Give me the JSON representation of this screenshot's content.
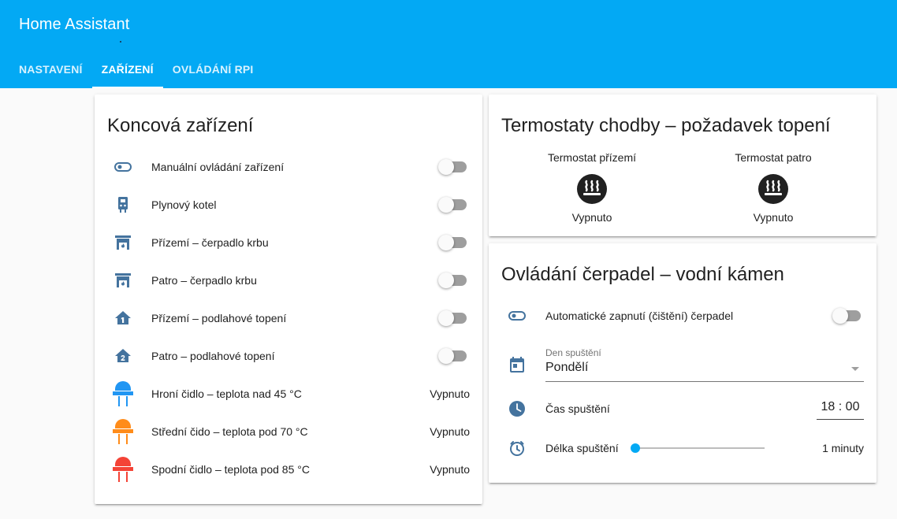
{
  "app": {
    "title": "Home Assistant"
  },
  "tabs": [
    {
      "label": "NASTAVENÍ",
      "active": false
    },
    {
      "label": "ZAŘÍZENÍ",
      "active": true
    },
    {
      "label": "OVLÁDÁNÍ RPI",
      "active": false
    }
  ],
  "colors": {
    "header": "#03a9f4",
    "icon": "#44739e",
    "sensor_blue": "#2196f3",
    "sensor_orange": "#ff8c1a",
    "sensor_red": "#f44336"
  },
  "devices_card": {
    "title": "Koncová zařízení",
    "rows": [
      {
        "icon": "toggle-switch-icon",
        "label": "Manuální ovládání zařízení",
        "type": "toggle",
        "on": false
      },
      {
        "icon": "gas-boiler-icon",
        "label": "Plynový kotel",
        "type": "toggle",
        "on": false
      },
      {
        "icon": "fireplace-icon",
        "label": "Přízemí – čerpadlo krbu",
        "type": "toggle",
        "on": false
      },
      {
        "icon": "fireplace-icon",
        "label": "Patro – čerpadlo krbu",
        "type": "toggle",
        "on": false
      },
      {
        "icon": "home-floor-1-icon",
        "label": "Přízemí – podlahové topení",
        "type": "toggle",
        "on": false
      },
      {
        "icon": "home-floor-2-icon",
        "label": "Patro – podlahové topení",
        "type": "toggle",
        "on": false
      },
      {
        "icon": "led-blue-icon",
        "label": "Hroní čidlo – teplota nad 45 °C",
        "type": "state",
        "state": "Vypnuto"
      },
      {
        "icon": "led-orange-icon",
        "label": "Střední čido – teplota pod 70 °C",
        "type": "state",
        "state": "Vypnuto"
      },
      {
        "icon": "led-red-icon",
        "label": "Spodní čidlo – teplota pod 85 °C",
        "type": "state",
        "state": "Vypnuto"
      }
    ]
  },
  "thermostats_card": {
    "title": "Termostaty chodby – požadavek topení",
    "items": [
      {
        "name": "Termostat přízemí",
        "icon": "radiator-icon",
        "state": "Vypnuto"
      },
      {
        "name": "Termostat patro",
        "icon": "radiator-icon",
        "state": "Vypnuto"
      }
    ]
  },
  "pumps_card": {
    "title": "Ovládání čerpadel – vodní kámen",
    "auto": {
      "icon": "toggle-switch-icon",
      "label": "Automatické zapnutí (čištění) čerpadel",
      "on": false
    },
    "day": {
      "icon": "calendar-icon",
      "caption": "Den spuštění",
      "value": "Pondělí"
    },
    "time": {
      "icon": "clock-icon",
      "label": "Čas spuštění",
      "value": "18 : 00"
    },
    "duration": {
      "icon": "timer-icon",
      "label": "Délka spuštění",
      "value": "1 minuty",
      "slider_fraction": 0
    }
  }
}
